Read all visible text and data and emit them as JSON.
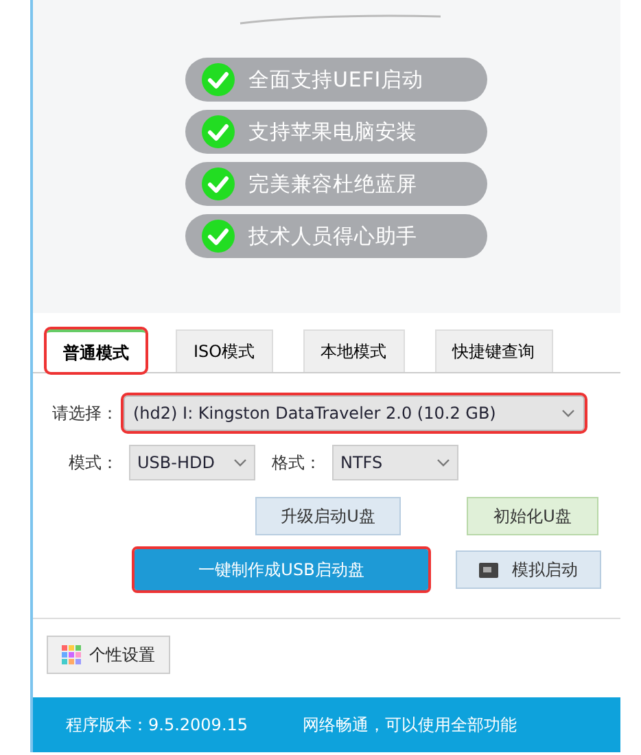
{
  "features": [
    {
      "label": "全面支持UEFI启动",
      "checked": true
    },
    {
      "label": "支持苹果电脑安装",
      "checked": true
    },
    {
      "label": "完美兼容杜绝蓝屏",
      "checked": true
    },
    {
      "label": "技术人员得心助手",
      "checked": true
    }
  ],
  "tabs": [
    {
      "label": "普通模式",
      "selected": true,
      "highlighted": true
    },
    {
      "label": "ISO模式",
      "selected": false,
      "highlighted": false
    },
    {
      "label": "本地模式",
      "selected": false,
      "highlighted": false
    },
    {
      "label": "快捷键查询",
      "selected": false,
      "highlighted": false
    }
  ],
  "device": {
    "label": "请选择：",
    "value": "(hd2) I: Kingston DataTraveler 2.0 (10.2 GB)",
    "highlighted": true
  },
  "mode": {
    "label": "模式：",
    "value": "USB-HDD"
  },
  "format": {
    "label": "格式：",
    "value": "NTFS"
  },
  "upgrade_button": "升级启动U盘",
  "init_button": "初始化U盘",
  "make_button": {
    "label": "一键制作成USB启动盘",
    "highlighted": true
  },
  "simulate_button": "模拟启动",
  "settings_button": "个性设置",
  "status_bar": {
    "version": "程序版本：9.5.2009.15",
    "network": "网络畅通，可以使用全部功能"
  }
}
